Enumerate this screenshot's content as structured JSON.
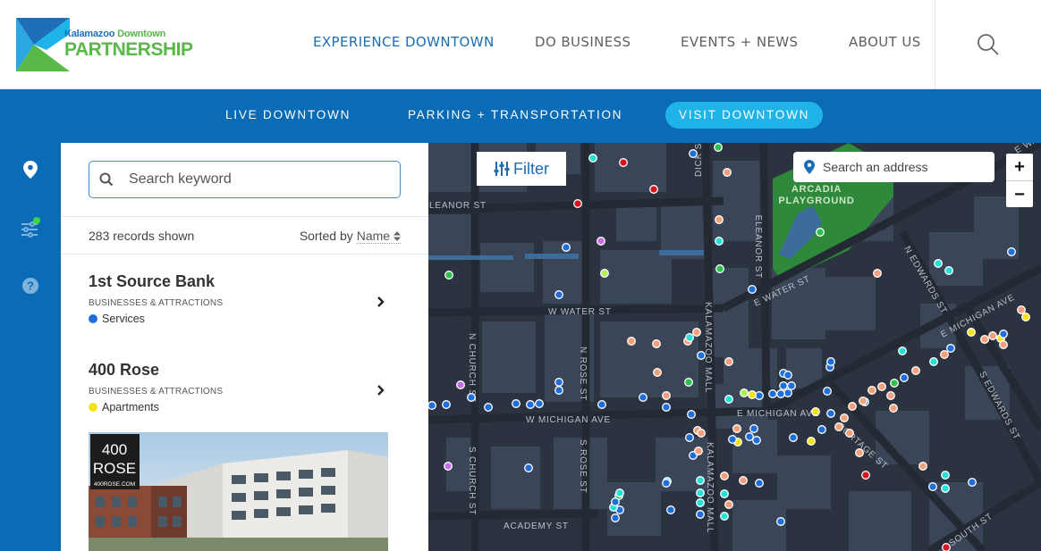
{
  "brand": {
    "small_word_1": "Kalamazoo",
    "small_word_2": "Downtown",
    "big": "PARTNERSHIP",
    "colors": {
      "blue": "#1d6fb8",
      "green": "#58b947",
      "cyan": "#1fb3ea"
    }
  },
  "main_nav": {
    "items": [
      {
        "label": "EXPERIENCE DOWNTOWN",
        "active": true
      },
      {
        "label": "DO BUSINESS",
        "active": false
      },
      {
        "label": "EVENTS + NEWS",
        "active": false
      },
      {
        "label": "ABOUT US",
        "active": false
      }
    ],
    "search_icon": "magnifier-icon"
  },
  "sub_nav": {
    "items": [
      {
        "label": "LIVE DOWNTOWN",
        "active": false
      },
      {
        "label": "PARKING + TRANSPORTATION",
        "active": false
      },
      {
        "label": "VISIT DOWNTOWN",
        "active": true
      }
    ]
  },
  "rail": {
    "icons": [
      "map-pin-icon",
      "filter-sliders-icon",
      "help-icon"
    ]
  },
  "list": {
    "search_placeholder": "Search keyword",
    "count_text": "283 records shown",
    "sorted_label": "Sorted by",
    "sorted_value": "Name",
    "records": [
      {
        "title": "1st Source Bank",
        "category": "BUSINESSES & ATTRACTIONS",
        "tag": "Services",
        "tag_color": "#1e6fd9"
      },
      {
        "title": "400 Rose",
        "category": "BUSINESSES & ATTRACTIONS",
        "tag": "Apartments",
        "tag_color": "#f5e21a"
      }
    ],
    "image_sign": {
      "line1": "400",
      "line2": "ROSE",
      "line3": "400ROSE.COM"
    }
  },
  "map": {
    "filter_label": "Filter",
    "address_placeholder": "Search an address",
    "zoom_in": "+",
    "zoom_out": "−",
    "park_name_1": "ARCADIA",
    "park_name_2": "PLAYGROUND",
    "streets": {
      "eleanor_w": "LEANOR ST",
      "dick": "DICK ST",
      "eleanor_n": "ELEANOR ST",
      "water_w": "W WATER ST",
      "water_e": "E WATER ST",
      "edwards_n": "N EDWARDS ST",
      "michigan_e_ne": "E MICHIGAN AVE",
      "church_n": "N CHURCH ST",
      "rose_n": "N ROSE ST",
      "kzoo_mall_n": "KALAMAZOO MALL",
      "michigan_w": "W MICHIGAN AVE",
      "michigan_e": "E MICHIGAN AVE",
      "edwards_s": "S EDWARDS ST",
      "portage": "PORTAGE ST",
      "church_s": "S CHURCH ST",
      "rose_s": "S ROSE ST",
      "kzoo_mall_s": "KALAMAZOO MALL",
      "academy": "ACADEMY ST",
      "south": "SOUTH ST",
      "water_ne": "E WAT"
    },
    "marker_colors": {
      "services": "#1e6fd9",
      "food": "#f4a07c",
      "shopping": "#27e1d8",
      "entertainment": "#2fbf4f",
      "apartments": "#f5e21a",
      "arts": "#c56fe6",
      "hotels": "#d9131b",
      "other": "#aef04c"
    }
  }
}
